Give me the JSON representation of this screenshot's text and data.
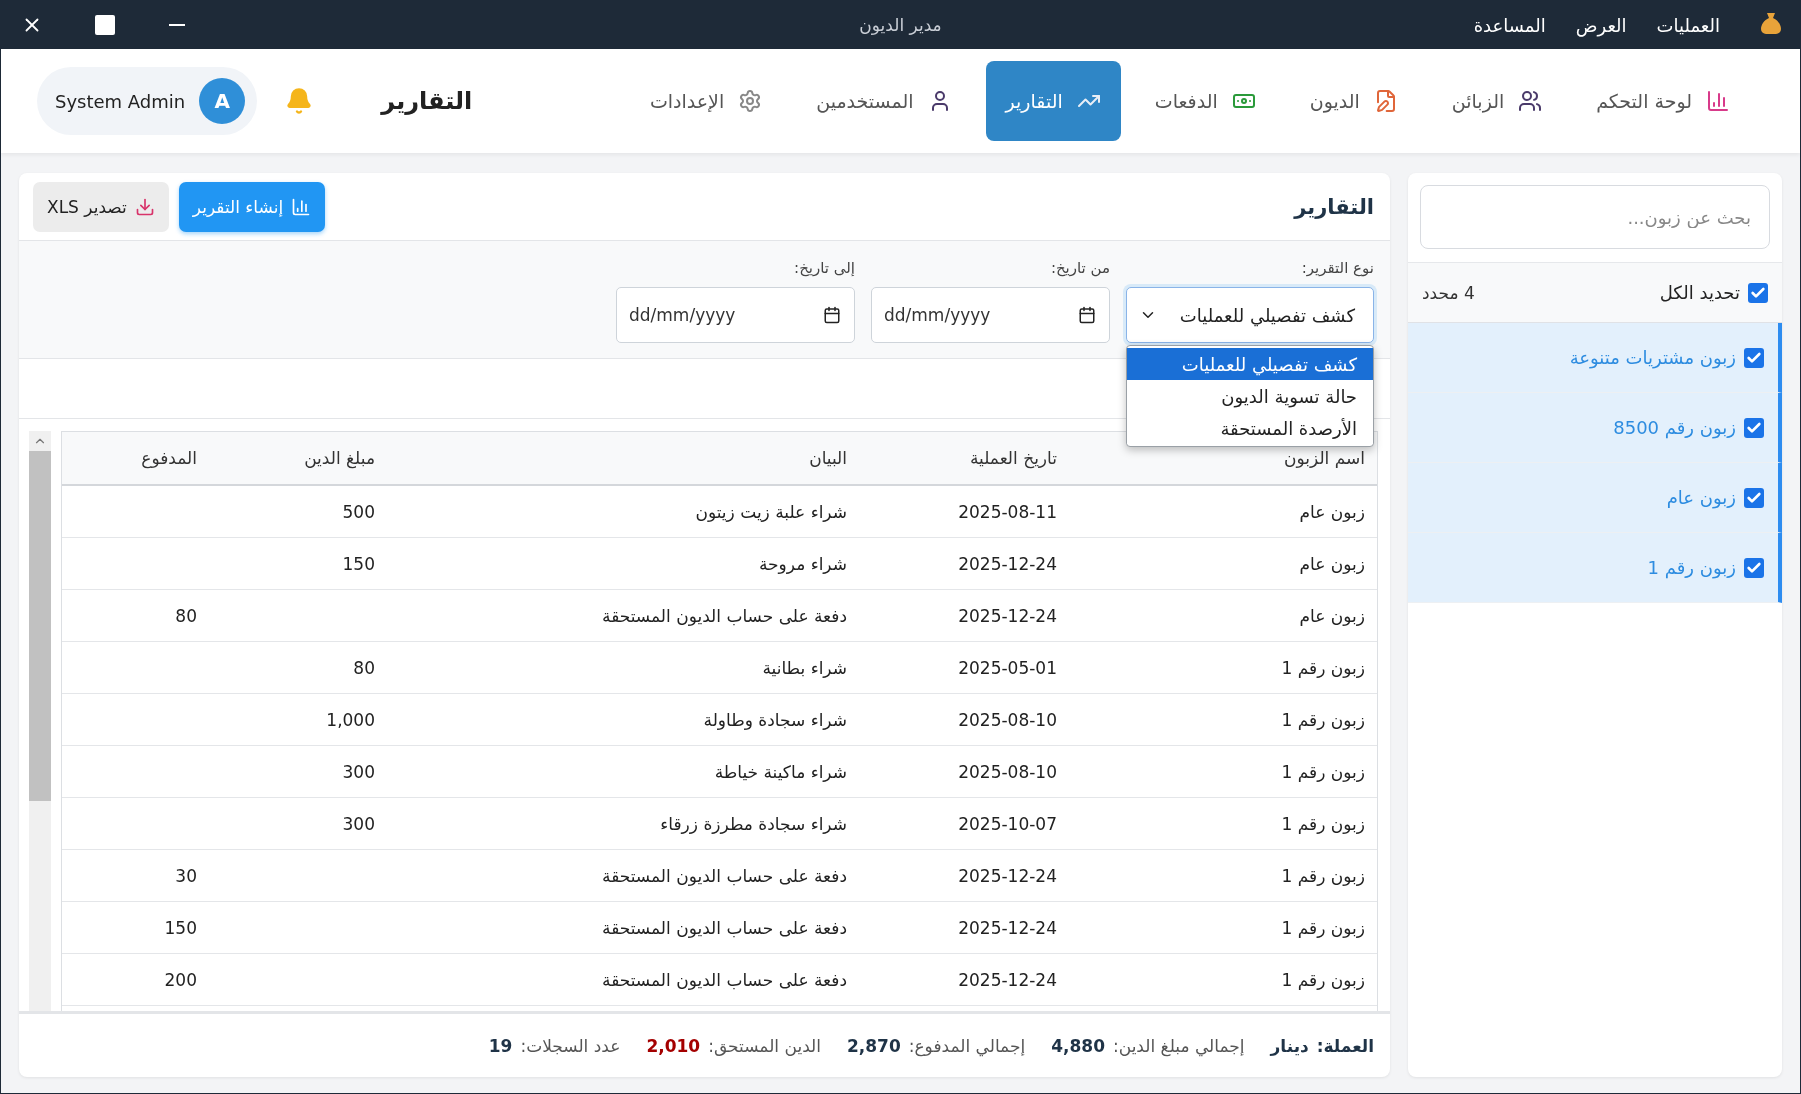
{
  "window": {
    "title": "مدير الديون",
    "menu": [
      "العمليات",
      "العرض",
      "المساعدة"
    ]
  },
  "nav": {
    "items": [
      {
        "label": "لوحة التحكم",
        "selected": false
      },
      {
        "label": "الزبائن",
        "selected": false
      },
      {
        "label": "الديون",
        "selected": false
      },
      {
        "label": "الدفعات",
        "selected": false
      },
      {
        "label": "التقارير",
        "selected": true
      },
      {
        "label": "المستخدمين",
        "selected": false
      },
      {
        "label": "الإعدادات",
        "selected": false
      }
    ],
    "page_title": "التقارير",
    "user": {
      "name": "System Admin",
      "initial": "A"
    }
  },
  "sidebar": {
    "search": {
      "placeholder": "بحث عن زبون..."
    },
    "select_all": {
      "label": "تحديد الكل",
      "checked": true
    },
    "count": "4 محدد",
    "customers": [
      {
        "name": "زبون مشتريات متنوعة",
        "checked": true
      },
      {
        "name": "زبون رقم 8500",
        "checked": true
      },
      {
        "name": "زبون عام",
        "checked": true
      },
      {
        "name": "زبون رقم 1",
        "checked": true
      }
    ]
  },
  "reports": {
    "title": "التقارير",
    "buttons": [
      {
        "label": "إنشاء التقرير",
        "kind": "primary"
      },
      {
        "label": "تصدير XLS",
        "kind": "secondary"
      }
    ],
    "filters": {
      "type": {
        "label": "نوع التقرير:",
        "value": "كشف تفصيلي للعمليات",
        "expanded": true,
        "options": [
          {
            "label": "كشف تفصيلي للعمليات",
            "selected": true
          },
          {
            "label": "حالة تسوية الديون",
            "selected": false
          },
          {
            "label": "الأرصدة المستحقة",
            "selected": false
          }
        ]
      },
      "from": {
        "label": "من تاريخ:",
        "placeholder": "dd/mm/yyyy"
      },
      "to": {
        "label": "إلى تاريخ:",
        "placeholder": "dd/mm/yyyy"
      }
    },
    "table": {
      "columns": [
        "اسم الزبون",
        "تاريخ العملية",
        "البيان",
        "مبلغ الدين",
        "المدفوع"
      ],
      "rows": [
        [
          "زبون عام",
          "2025-08-11",
          "شراء علبة زيت زيتون",
          "500",
          ""
        ],
        [
          "زبون عام",
          "2025-12-24",
          "شراء مروحة",
          "150",
          ""
        ],
        [
          "زبون عام",
          "2025-12-24",
          "دفعة على حساب الديون المستحقة",
          "",
          "80"
        ],
        [
          "زبون رقم 1",
          "2025-05-01",
          "شراء بطانية",
          "80",
          ""
        ],
        [
          "زبون رقم 1",
          "2025-08-10",
          "شراء سجادة وطاولة",
          "1,000",
          ""
        ],
        [
          "زبون رقم 1",
          "2025-08-10",
          "شراء ماكينة خياطة",
          "300",
          ""
        ],
        [
          "زبون رقم 1",
          "2025-10-07",
          "شراء سجادة مطرزة زرقاء",
          "300",
          ""
        ],
        [
          "زبون رقم 1",
          "2025-12-24",
          "دفعة على حساب الديون المستحقة",
          "",
          "30"
        ],
        [
          "زبون رقم 1",
          "2025-12-24",
          "دفعة على حساب الديون المستحقة",
          "",
          "150"
        ],
        [
          "زبون رقم 1",
          "2025-12-24",
          "دفعة على حساب الديون المستحقة",
          "",
          "200"
        ]
      ]
    },
    "footer": [
      {
        "label": "العملة:",
        "value": "دينار",
        "kind": "strong"
      },
      {
        "label": "إجمالي مبلغ الدين:",
        "value": "4,880",
        "kind": "normal"
      },
      {
        "label": "إجمالي المدفوع:",
        "value": "2,870",
        "kind": "normal"
      },
      {
        "label": "الدين المستحق:",
        "value": "2,010",
        "kind": "danger"
      },
      {
        "label": "عدد السجلات:",
        "value": "19",
        "kind": "normal"
      }
    ]
  }
}
